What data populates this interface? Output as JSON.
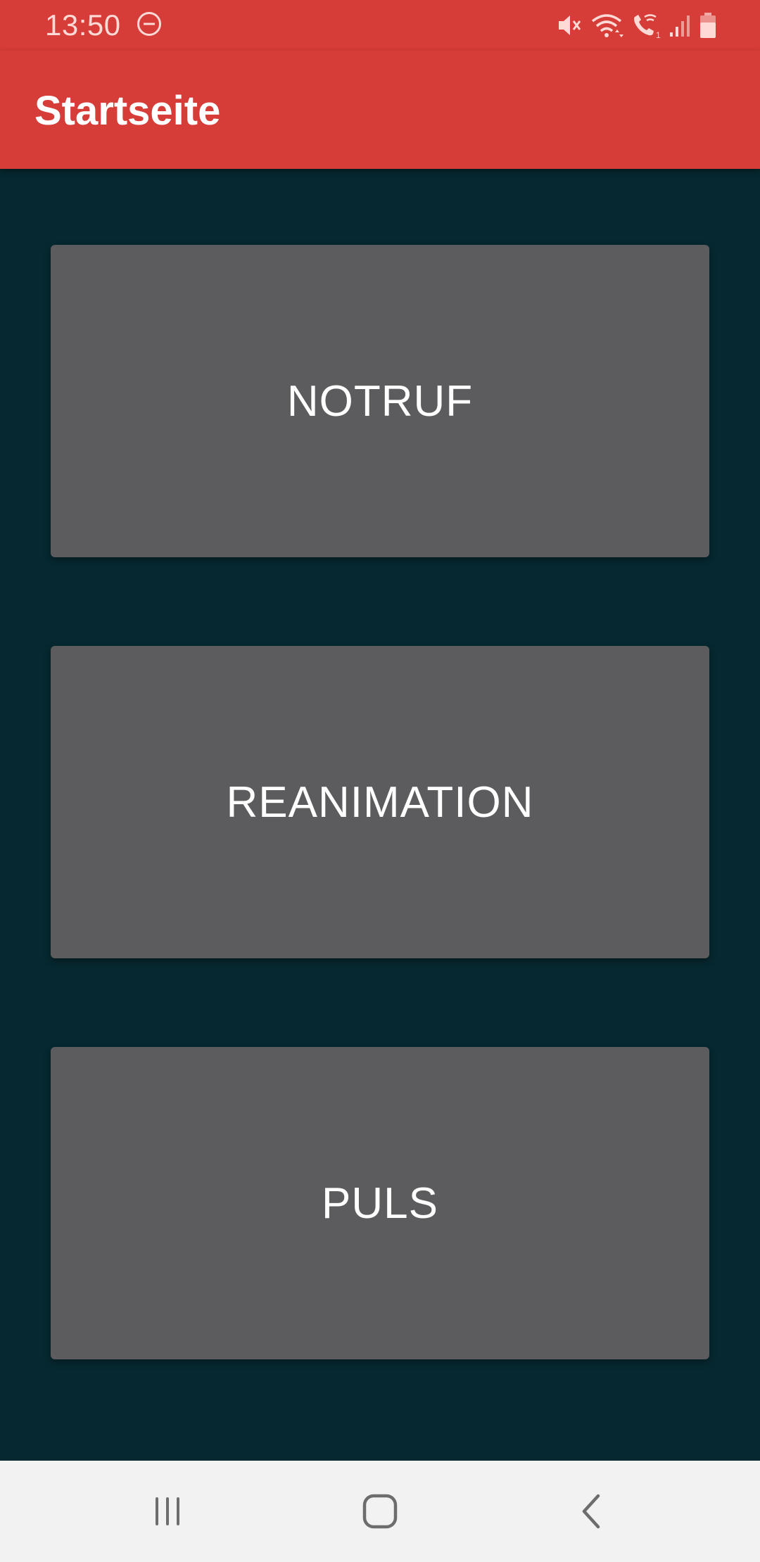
{
  "status_bar": {
    "time": "13:50",
    "icons": [
      "do-not-disturb-icon",
      "mute-icon",
      "wifi-icon",
      "wifi-calling-icon",
      "signal-icon",
      "battery-icon"
    ]
  },
  "app_bar": {
    "title": "Startseite"
  },
  "menu": {
    "items": [
      {
        "label": "NOTRUF"
      },
      {
        "label": "REANIMATION"
      },
      {
        "label": "PULS"
      }
    ]
  },
  "nav_bar": {
    "icons": [
      "recents-icon",
      "home-icon",
      "back-icon"
    ]
  },
  "colors": {
    "primary": "#d63c38",
    "background": "#062830",
    "button": "#5c5c5e",
    "nav_bar": "#f2f2f2"
  }
}
